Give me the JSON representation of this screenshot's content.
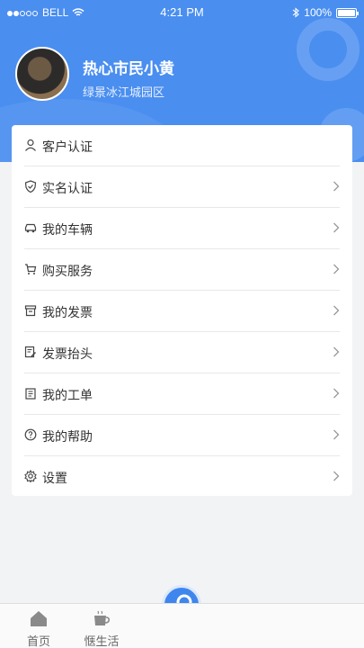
{
  "status": {
    "carrier": "BELL",
    "time": "4:21 PM",
    "battery": "100%",
    "battery_level": 1.0
  },
  "profile": {
    "name": "热心市民小黄",
    "community": "绿景冰江城园区"
  },
  "menu": [
    {
      "label": "客户认证",
      "icon": "person-icon",
      "chevron": false
    },
    {
      "label": "实名认证",
      "icon": "shield-icon",
      "chevron": true
    },
    {
      "label": "我的车辆",
      "icon": "car-icon",
      "chevron": true
    },
    {
      "label": "购买服务",
      "icon": "cart-icon",
      "chevron": true
    },
    {
      "label": "我的发票",
      "icon": "invoice-box-icon",
      "chevron": true
    },
    {
      "label": "发票抬头",
      "icon": "edit-document-icon",
      "chevron": true
    },
    {
      "label": "我的工单",
      "icon": "clipboard-icon",
      "chevron": true
    },
    {
      "label": "我的帮助",
      "icon": "help-circle-icon",
      "chevron": true
    },
    {
      "label": "设置",
      "icon": "gear-icon",
      "chevron": true
    }
  ],
  "tabs": [
    {
      "label": "首页",
      "icon": "home-icon"
    },
    {
      "label": "惬生活",
      "icon": "coffee-cup-icon"
    }
  ],
  "colors": {
    "header": "#4a8ef0",
    "fab": "#3e86ee",
    "background": "#f2f3f5"
  },
  "fab_icon": "key-icon"
}
